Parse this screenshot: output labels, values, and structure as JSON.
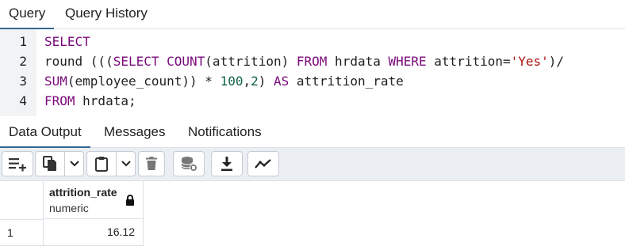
{
  "tabs": {
    "query": "Query",
    "history": "Query History"
  },
  "editor": {
    "lines": [
      {
        "num": "1",
        "parts": [
          {
            "t": "SELECT",
            "c": "kw"
          }
        ]
      },
      {
        "num": "2",
        "parts": [
          {
            "t": "round (((",
            "c": ""
          },
          {
            "t": "SELECT COUNT",
            "c": "kw"
          },
          {
            "t": "(attrition) ",
            "c": ""
          },
          {
            "t": "FROM",
            "c": "kw"
          },
          {
            "t": " hrdata ",
            "c": ""
          },
          {
            "t": "WHERE",
            "c": "kw"
          },
          {
            "t": " attrition=",
            "c": ""
          },
          {
            "t": "'Yes'",
            "c": "str"
          },
          {
            "t": ")/",
            "c": ""
          }
        ]
      },
      {
        "num": "3",
        "parts": [
          {
            "t": "SUM",
            "c": "kw"
          },
          {
            "t": "(employee_count)) * ",
            "c": ""
          },
          {
            "t": "100",
            "c": "num"
          },
          {
            "t": ",",
            "c": ""
          },
          {
            "t": "2",
            "c": "num"
          },
          {
            "t": ") ",
            "c": ""
          },
          {
            "t": "AS",
            "c": "kw"
          },
          {
            "t": " attrition_rate",
            "c": ""
          }
        ]
      },
      {
        "num": "4",
        "parts": [
          {
            "t": "FROM",
            "c": "kw"
          },
          {
            "t": " hrdata;",
            "c": ""
          }
        ]
      }
    ]
  },
  "output_tabs": {
    "data": "Data Output",
    "messages": "Messages",
    "notifications": "Notifications"
  },
  "toolbar": {
    "icons": [
      "add-row-icon",
      "copy-icon",
      "chevron-down-icon",
      "paste-icon",
      "chevron-down-icon",
      "delete-icon",
      "save-data-icon",
      "download-icon",
      "graph-icon"
    ]
  },
  "grid": {
    "column": {
      "name": "attrition_rate",
      "type": "numeric"
    },
    "rows": [
      {
        "num": "1",
        "value": "16.12"
      }
    ]
  }
}
